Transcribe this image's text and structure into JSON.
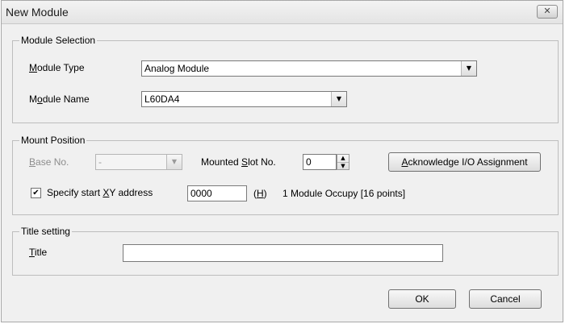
{
  "window": {
    "title": "New Module",
    "close_glyph": "✕"
  },
  "module_selection": {
    "legend": "Module Selection",
    "type_label": "Module Type",
    "type_value": "Analog Module",
    "name_label": "Module Name",
    "name_value": "L60DA4"
  },
  "mount_position": {
    "legend": "Mount Position",
    "base_label": "Base No.",
    "base_value": "-",
    "slot_label": "Mounted Slot No.",
    "slot_value": "0",
    "ack_button": "Acknowledge I/O Assignment",
    "specify_checked": true,
    "specify_label": "Specify start XY address",
    "address_value": "0000",
    "hex_suffix": "(H)",
    "occupy_text": "1 Module Occupy [16 points]"
  },
  "title_setting": {
    "legend": "Title setting",
    "title_label": "Title",
    "title_value": ""
  },
  "buttons": {
    "ok": "OK",
    "cancel": "Cancel"
  },
  "icons": {
    "dropdown": "▼",
    "spin_up": "▲",
    "spin_down": "▼",
    "check": "✔"
  }
}
